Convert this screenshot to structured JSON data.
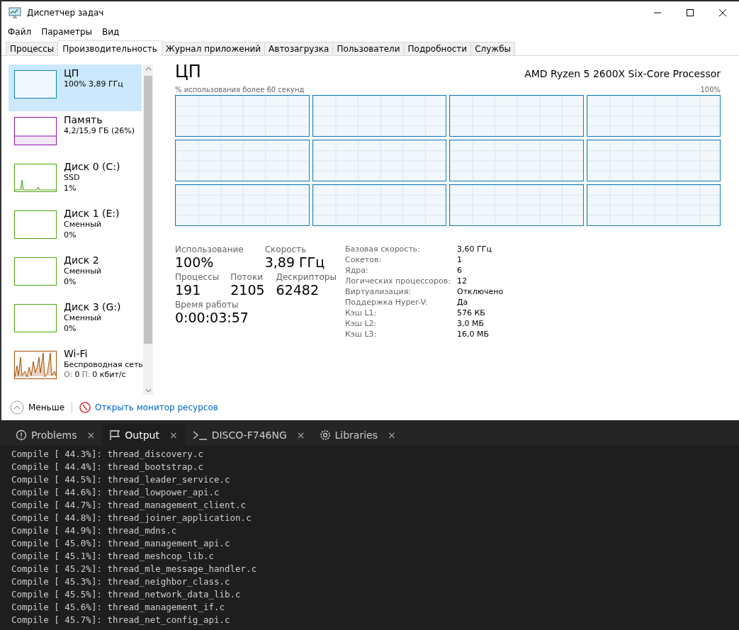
{
  "window": {
    "title": "Диспетчер задач"
  },
  "menu": [
    "Файл",
    "Параметры",
    "Вид"
  ],
  "tabs": [
    {
      "label": "Процессы",
      "selected": false
    },
    {
      "label": "Производительность",
      "selected": true
    },
    {
      "label": "Журнал приложений",
      "selected": false
    },
    {
      "label": "Автозагрузка",
      "selected": false
    },
    {
      "label": "Пользователи",
      "selected": false
    },
    {
      "label": "Подробности",
      "selected": false
    },
    {
      "label": "Службы",
      "selected": false
    }
  ],
  "sidebar": {
    "items": [
      {
        "kind": "cpu",
        "name": "ЦП",
        "lines": [
          "100% 3,89 ГГц"
        ],
        "color": "#117dbb",
        "selected": true
      },
      {
        "kind": "memory",
        "name": "Память",
        "lines": [
          "4,2/15,9 ГБ (26%)"
        ],
        "color": "#8b12ae",
        "selected": false
      },
      {
        "kind": "disk",
        "name": "Диск 0 (C:)",
        "lines": [
          "SSD",
          "1%"
        ],
        "color": "#4da60c",
        "selected": false
      },
      {
        "kind": "idle",
        "name": "Диск 1 (E:)",
        "lines": [
          "Сменный",
          "0%"
        ],
        "color": "#4da60c",
        "selected": false
      },
      {
        "kind": "idle",
        "name": "Диск 2",
        "lines": [
          "Сменный",
          "0%"
        ],
        "color": "#4da60c",
        "selected": false
      },
      {
        "kind": "idle",
        "name": "Диск 3 (G:)",
        "lines": [
          "Сменный",
          "0%"
        ],
        "color": "#4da60c",
        "selected": false
      },
      {
        "kind": "network",
        "name": "Wi-Fi",
        "lines": [
          "Беспроводная сеть"
        ],
        "send_label": "О:",
        "send": "0",
        "recv_label": "П:",
        "recv": "0 кбит/с",
        "color": "#a74f01",
        "selected": false
      }
    ]
  },
  "cpu": {
    "title": "ЦП",
    "model": "AMD Ryzen 5 2600X Six-Core Processor",
    "graph_caption": "% использования более 60 секунд",
    "graph_max": "100%",
    "stats": [
      {
        "label": "Использование",
        "value": "100%"
      },
      {
        "label": "Скорость",
        "value": "3,89 ГГц"
      },
      {
        "label": "Процессы",
        "value": "191"
      },
      {
        "label": "Потоки",
        "value": "2105"
      },
      {
        "label": "Дескрипторы",
        "value": "62482"
      },
      {
        "label": "Время работы",
        "value": "0:00:03:57"
      }
    ],
    "details": [
      [
        "Базовая скорость:",
        "3,60 ГГц"
      ],
      [
        "Сокетов:",
        "1"
      ],
      [
        "Ядра:",
        "6"
      ],
      [
        "Логических процессоров:",
        "12"
      ],
      [
        "Виртуализация:",
        "Отключено"
      ],
      [
        "Поддержка Hyper-V:",
        "Да"
      ],
      [
        "Кэш L1:",
        "576 КБ"
      ],
      [
        "Кэш L2:",
        "3,0 МБ"
      ],
      [
        "Кэш L3:",
        "16,0 МБ"
      ]
    ]
  },
  "footer": {
    "less": "Меньше",
    "monitor_link": "Открыть монитор ресурсов"
  },
  "panel": {
    "tabs": [
      {
        "kind": "problems",
        "label": "Problems",
        "selected": false
      },
      {
        "kind": "output",
        "label": "Output",
        "selected": true
      },
      {
        "kind": "terminal",
        "label": "DISCO-F746NG",
        "selected": false
      },
      {
        "kind": "libraries",
        "label": "Libraries",
        "selected": false
      }
    ],
    "close": "×",
    "lines": [
      "Compile [ 44.3%]: thread_discovery.c",
      "Compile [ 44.4%]: thread_bootstrap.c",
      "Compile [ 44.5%]: thread_leader_service.c",
      "Compile [ 44.6%]: thread_lowpower_api.c",
      "Compile [ 44.7%]: thread_management_client.c",
      "Compile [ 44.8%]: thread_joiner_application.c",
      "Compile [ 44.9%]: thread_mdns.c",
      "Compile [ 45.0%]: thread_management_api.c",
      "Compile [ 45.1%]: thread_meshcop_lib.c",
      "Compile [ 45.2%]: thread_mle_message_handler.c",
      "Compile [ 45.3%]: thread_neighbor_class.c",
      "Compile [ 45.5%]: thread_network_data_lib.c",
      "Compile [ 45.6%]: thread_management_if.c",
      "Compile [ 45.7%]: thread_net_config_api.c"
    ]
  }
}
